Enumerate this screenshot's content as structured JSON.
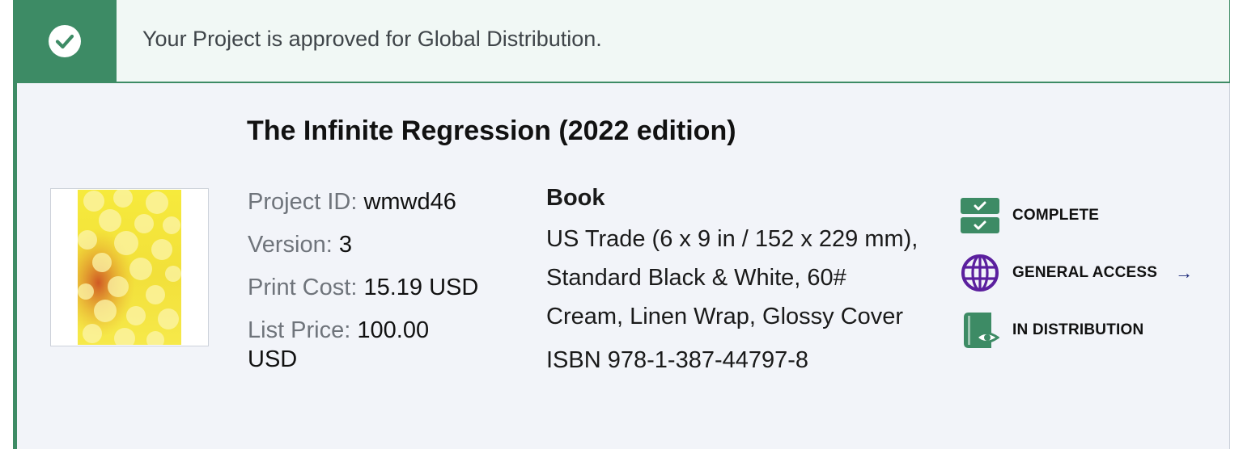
{
  "banner": {
    "message": "Your Project is approved for Global Distribution.",
    "icon": "check-circle-icon"
  },
  "project": {
    "title": "The Infinite Regression (2022 edition)",
    "id_label": "Project ID:",
    "id_value": "wmwd46",
    "version_label": "Version:",
    "version_value": "3",
    "print_cost_label": "Print Cost:",
    "print_cost_value": "15.19 USD",
    "list_price_label": "List Price:",
    "list_price_value": "100.00 USD"
  },
  "product": {
    "type": "Book",
    "description": "US Trade (6 x 9 in / 152 x 229 mm), Standard Black & White, 60# Cream, Linen Wrap, Glossy Cover",
    "isbn": "ISBN 978-1-387-44797-8"
  },
  "status": [
    {
      "label": "COMPLETE",
      "icon": "checklist-icon"
    },
    {
      "label": "GENERAL ACCESS",
      "icon": "globe-icon",
      "arrow": "→"
    },
    {
      "label": "IN DISTRIBUTION",
      "icon": "book-eye-icon"
    }
  ],
  "colors": {
    "success_green": "#3d8b65",
    "globe_purple": "#5b1f9e",
    "arrow_navy": "#1e2a7a"
  }
}
